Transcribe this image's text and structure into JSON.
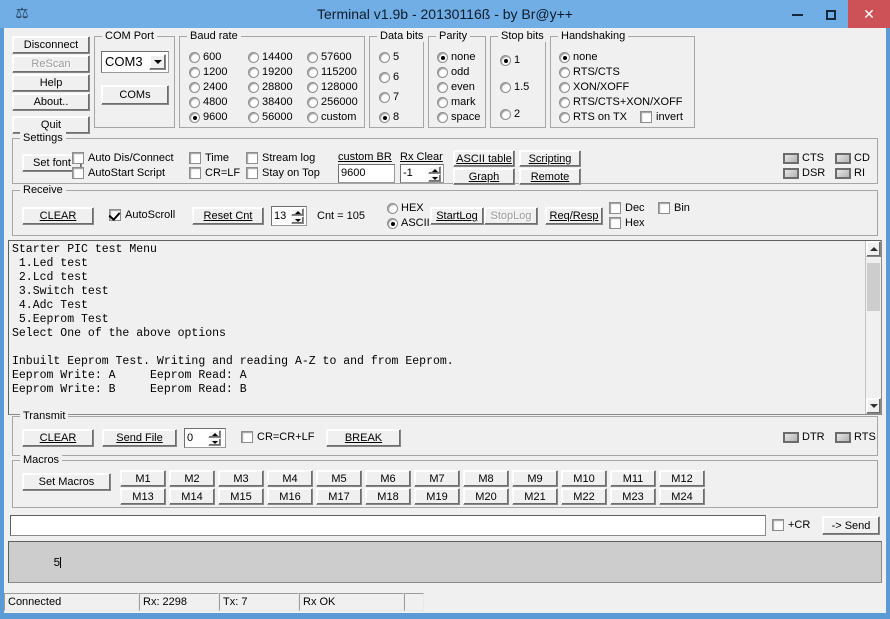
{
  "window": {
    "title": "Terminal v1.9b - 20130116ß - by Br@y++",
    "app_icon": "terminal-app-icon",
    "minimize": "–",
    "maximize": "□",
    "close": "✕",
    "titlebar_color": "#72aee6",
    "close_color": "#cc5257"
  },
  "left_buttons": [
    {
      "label": "Disconnect",
      "name": "disconnect-button",
      "disabled": false
    },
    {
      "label": "ReScan",
      "name": "rescan-button",
      "disabled": true
    },
    {
      "label": "Help",
      "name": "help-button",
      "disabled": false
    },
    {
      "label": "About..",
      "name": "about-button",
      "disabled": false
    },
    {
      "label": "Quit",
      "name": "quit-button",
      "disabled": false
    }
  ],
  "com_port": {
    "legend": "COM Port",
    "selected": "COM3",
    "coms_button": "COMs"
  },
  "baud_rate": {
    "legend": "Baud rate",
    "selected": "9600",
    "col1": [
      "600",
      "1200",
      "2400",
      "4800",
      "9600"
    ],
    "col2": [
      "14400",
      "19200",
      "28800",
      "38400",
      "56000"
    ],
    "col3": [
      "57600",
      "115200",
      "128000",
      "256000",
      "custom"
    ]
  },
  "data_bits": {
    "legend": "Data bits",
    "selected": "8",
    "options": [
      "5",
      "6",
      "7",
      "8"
    ]
  },
  "parity": {
    "legend": "Parity",
    "selected": "none",
    "options": [
      "none",
      "odd",
      "even",
      "mark",
      "space"
    ]
  },
  "stop_bits": {
    "legend": "Stop bits",
    "selected": "1",
    "options": [
      "1",
      "1.5",
      "2"
    ]
  },
  "handshaking": {
    "legend": "Handshaking",
    "selected": "none",
    "options": [
      "none",
      "RTS/CTS",
      "XON/XOFF",
      "RTS/CTS+XON/XOFF",
      "RTS on TX"
    ],
    "invert_label": "invert",
    "invert_checked": false
  },
  "settings": {
    "legend": "Settings",
    "set_font": "Set font",
    "checks": [
      {
        "label": "Auto Dis/Connect",
        "checked": false
      },
      {
        "label": "AutoStart Script",
        "checked": false
      },
      {
        "label": "Time",
        "checked": false
      },
      {
        "label": "CR=LF",
        "checked": false
      },
      {
        "label": "Stream log",
        "checked": false
      },
      {
        "label": "Stay on Top",
        "checked": false
      }
    ],
    "custom_br_label": "custom BR",
    "custom_br_value": "9600",
    "rx_clear_label": "Rx Clear",
    "rx_clear_value": "-1",
    "ascii_table": "ASCII table",
    "graph": "Graph",
    "scripting": "Scripting",
    "remote": "Remote",
    "leds": [
      "CTS",
      "CD",
      "DSR",
      "RI"
    ]
  },
  "receive": {
    "legend": "Receive",
    "clear": "CLEAR",
    "autoscroll_label": "AutoScroll",
    "autoscroll_checked": true,
    "reset_cnt": "Reset Cnt",
    "cnt_field": "13",
    "cnt_label": "Cnt = 105",
    "hex_label": "HEX",
    "ascii_label": "ASCII",
    "mode_selected": "ASCII",
    "startlog": "StartLog",
    "stoplog": "StopLog",
    "stoplog_disabled": true,
    "req_resp": "Req/Resp",
    "dec_label": "Dec",
    "dec_checked": false,
    "hex2_label": "Hex",
    "hex2_checked": false,
    "bin_label": "Bin",
    "bin_checked": false
  },
  "terminal": {
    "text": "Starter PIC test Menu\n 1.Led test\n 2.Lcd test\n 3.Switch test\n 4.Adc Test\n 5.Eeprom Test\nSelect One of the above options\n\nInbuilt Eeprom Test. Writing and reading A-Z to and from Eeprom.\nEeprom Write: A     Eeprom Read: A\nEeprom Write: B     Eeprom Read: B"
  },
  "transmit": {
    "legend": "Transmit",
    "clear": "CLEAR",
    "send_file": "Send File",
    "delay_value": "0",
    "crcrlf_label": "CR=CR+LF",
    "crcrlf_checked": false,
    "break": "BREAK",
    "leds": [
      "DTR",
      "RTS"
    ]
  },
  "macros": {
    "legend": "Macros",
    "set_macros": "Set Macros",
    "row1": [
      "M1",
      "M2",
      "M3",
      "M4",
      "M5",
      "M6",
      "M7",
      "M8",
      "M9",
      "M10",
      "M11",
      "M12"
    ],
    "row2": [
      "M13",
      "M14",
      "M15",
      "M16",
      "M17",
      "M18",
      "M19",
      "M20",
      "M21",
      "M22",
      "M23",
      "M24"
    ]
  },
  "send_bar": {
    "input_value": "",
    "cr_label": "+CR",
    "cr_checked": false,
    "send_button": "-> Send"
  },
  "edit_area": {
    "value": "5"
  },
  "status_bar": {
    "cells": [
      "Connected",
      "Rx: 2298",
      "Tx: 7",
      "Rx OK",
      ""
    ]
  }
}
